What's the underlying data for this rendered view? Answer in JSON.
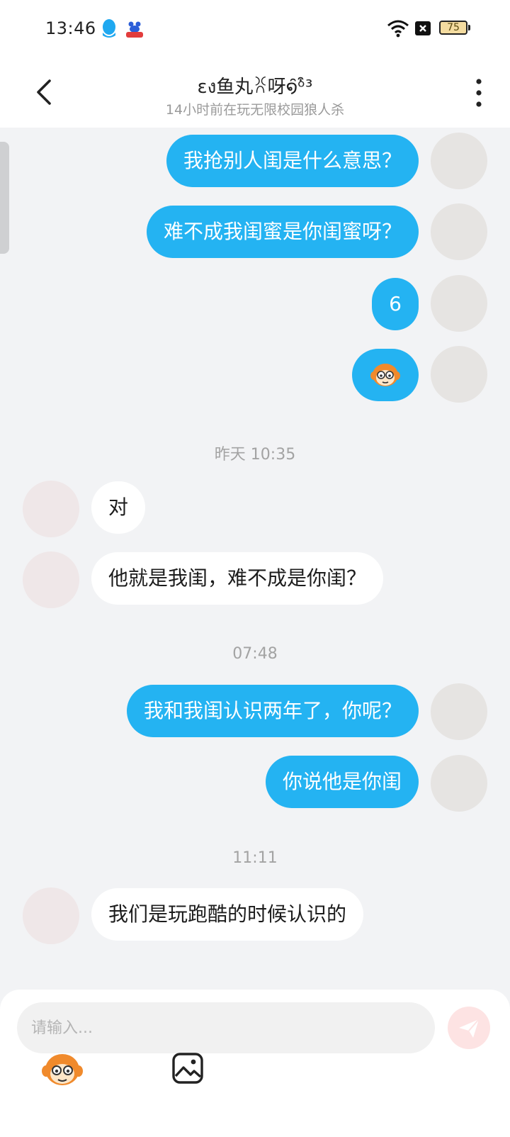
{
  "status_bar": {
    "time": "13:46",
    "battery": "75"
  },
  "header": {
    "title": "ɛง鱼丸ꐦ呀໑̑ᵒ͒³",
    "subtitle": "14小时前在玩无限校园狼人杀"
  },
  "messages": [
    {
      "side": "me",
      "text": "我抢别人闺是什么意思？"
    },
    {
      "side": "me",
      "text": "难不成我闺蜜是你闺蜜呀？"
    },
    {
      "side": "me",
      "text": "6"
    },
    {
      "side": "me",
      "sticker": "monkey-face-sticker"
    },
    {
      "timestamp": "昨天 10:35"
    },
    {
      "side": "other",
      "text": "对"
    },
    {
      "side": "other",
      "text": "他就是我闺，难不成是你闺？"
    },
    {
      "timestamp": "07:48"
    },
    {
      "side": "me",
      "text": "我和我闺认识两年了，你呢？"
    },
    {
      "side": "me",
      "text": "你说他是你闺"
    },
    {
      "timestamp": "11:11"
    },
    {
      "side": "other",
      "text": "我们是玩跑酷的时候认识的"
    }
  ],
  "composer": {
    "placeholder": "请输入..."
  },
  "colors": {
    "my_bubble": "#24b3f2",
    "other_bubble": "#ffffff",
    "send_button": "#fde3e3"
  },
  "icons": [
    "qq-icon",
    "baidu-icon",
    "wifi-icon",
    "x-notification-icon",
    "battery-icon",
    "back-icon",
    "more-icon",
    "send-icon",
    "emoji-icon",
    "image-icon"
  ]
}
